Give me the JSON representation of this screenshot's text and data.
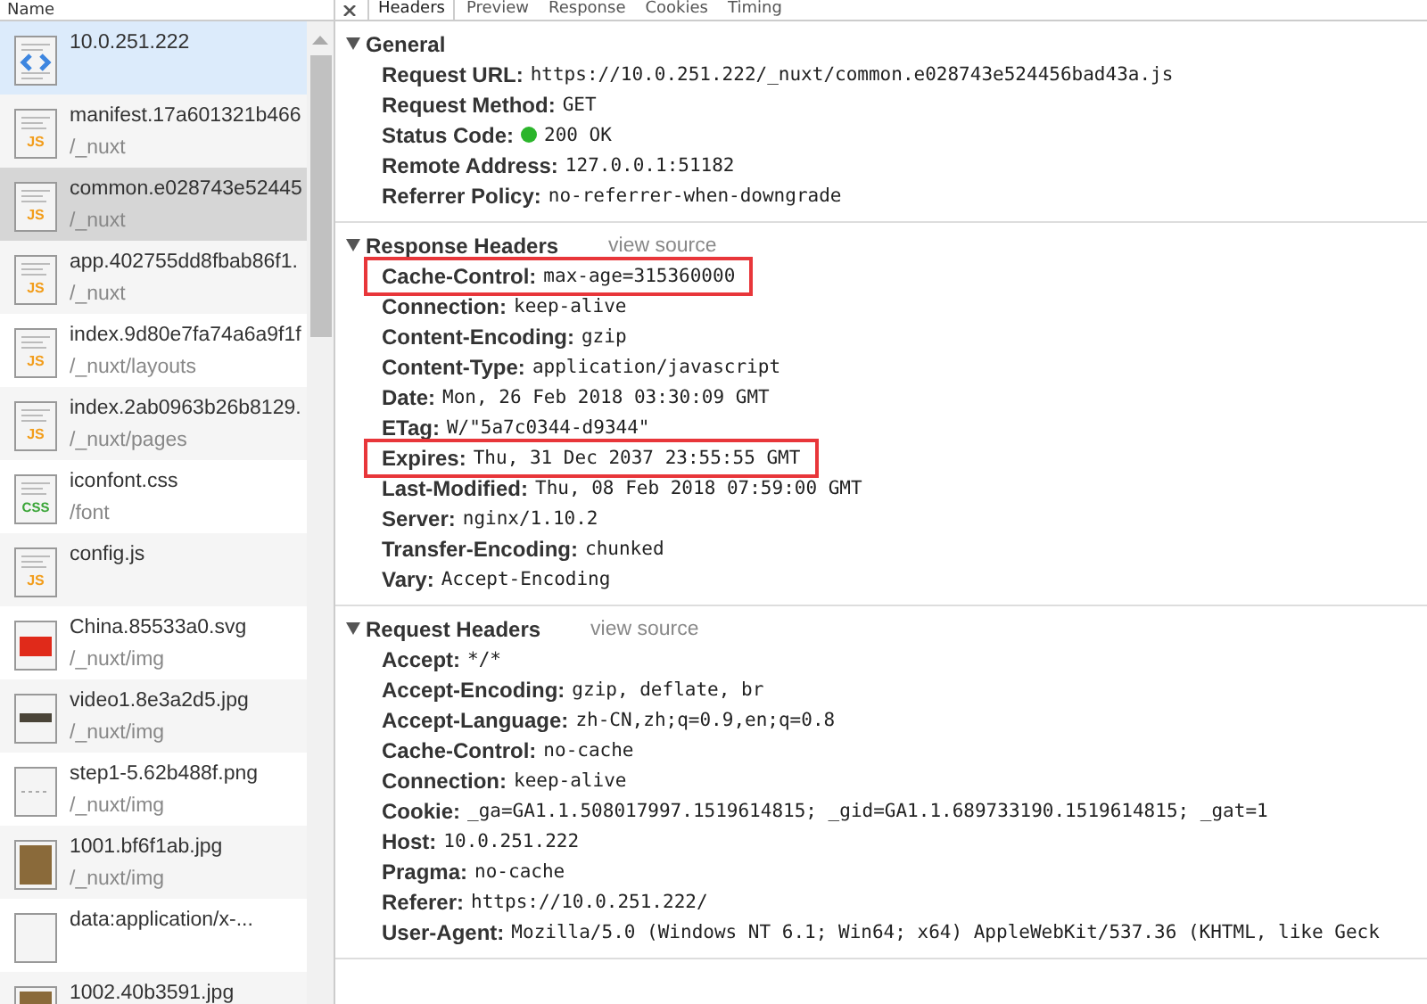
{
  "name_column": {
    "title": "Name"
  },
  "requests": [
    {
      "name": "10.0.251.222",
      "kind": "html",
      "selected": false,
      "highlighted": true
    },
    {
      "name": "manifest.17a601321b466",
      "path": "/_nuxt",
      "kind": "js",
      "icon_label": "JS",
      "selected": false,
      "highlighted": false
    },
    {
      "name": "common.e028743e52445",
      "path": "/_nuxt",
      "kind": "js",
      "icon_label": "JS",
      "selected": true,
      "highlighted": false
    },
    {
      "name": "app.402755dd8fbab86f1.",
      "path": "/_nuxt",
      "kind": "js",
      "icon_label": "JS",
      "selected": false,
      "highlighted": false
    },
    {
      "name": "index.9d80e7fa74a6a9f1f",
      "path": "/_nuxt/layouts",
      "kind": "js",
      "icon_label": "JS",
      "selected": false,
      "highlighted": false
    },
    {
      "name": "index.2ab0963b26b8129.",
      "path": "/_nuxt/pages",
      "kind": "js",
      "icon_label": "JS",
      "selected": false,
      "highlighted": false
    },
    {
      "name": "iconfont.css",
      "path": "/font",
      "kind": "css",
      "icon_label": "CSS",
      "selected": false,
      "highlighted": false
    },
    {
      "name": "config.js",
      "kind": "js",
      "icon_label": "JS",
      "selected": false,
      "highlighted": false
    },
    {
      "name": "China.85533a0.svg",
      "path": "/_nuxt/img",
      "kind": "flag",
      "selected": false,
      "highlighted": false
    },
    {
      "name": "video1.8e3a2d5.jpg",
      "path": "/_nuxt/img",
      "kind": "video",
      "selected": false,
      "highlighted": false
    },
    {
      "name": "step1-5.62b488f.png",
      "path": "/_nuxt/img",
      "kind": "strip",
      "selected": false,
      "highlighted": false
    },
    {
      "name": "1001.bf6f1ab.jpg",
      "path": "/_nuxt/img",
      "kind": "photo",
      "selected": false,
      "highlighted": false
    },
    {
      "name": "data:application/x-...",
      "kind": "blank",
      "selected": false,
      "highlighted": false
    },
    {
      "name": "1002.40b3591.jpg",
      "kind": "photo",
      "selected": false,
      "highlighted": false
    }
  ],
  "tabs": [
    {
      "label": "Headers",
      "selected": true
    },
    {
      "label": "Preview",
      "selected": false
    },
    {
      "label": "Response",
      "selected": false
    },
    {
      "label": "Cookies",
      "selected": false
    },
    {
      "label": "Timing",
      "selected": false
    }
  ],
  "sections": [
    {
      "title": "General",
      "items": [
        {
          "name": "Request URL:",
          "value": "https://10.0.251.222/_nuxt/common.e028743e524456bad43a.js",
          "kind": "plain",
          "highlighted": false
        },
        {
          "name": "Request Method:",
          "value": "GET",
          "kind": "plain",
          "highlighted": false
        },
        {
          "name": "Status Code:",
          "value": "200 OK",
          "kind": "status",
          "highlighted": false
        },
        {
          "name": "Remote Address:",
          "value": "127.0.0.1:51182",
          "kind": "plain",
          "highlighted": false
        },
        {
          "name": "Referrer Policy:",
          "value": "no-referrer-when-downgrade",
          "kind": "plain",
          "highlighted": false
        }
      ]
    },
    {
      "title": "Response Headers",
      "view_source": "view source",
      "items": [
        {
          "name": "Cache-Control:",
          "value": "max-age=315360000",
          "kind": "plain",
          "highlighted": true
        },
        {
          "name": "Connection:",
          "value": "keep-alive",
          "kind": "plain",
          "highlighted": false
        },
        {
          "name": "Content-Encoding:",
          "value": "gzip",
          "kind": "plain",
          "highlighted": false
        },
        {
          "name": "Content-Type:",
          "value": "application/javascript",
          "kind": "plain",
          "highlighted": false
        },
        {
          "name": "Date:",
          "value": "Mon, 26 Feb 2018 03:30:09 GMT",
          "kind": "plain",
          "highlighted": false
        },
        {
          "name": "ETag:",
          "value": "W/\"5a7c0344-d9344\"",
          "kind": "plain",
          "highlighted": false
        },
        {
          "name": "Expires:",
          "value": "Thu, 31 Dec 2037 23:55:55 GMT",
          "kind": "plain",
          "highlighted": true
        },
        {
          "name": "Last-Modified:",
          "value": "Thu, 08 Feb 2018 07:59:00 GMT",
          "kind": "plain",
          "highlighted": false
        },
        {
          "name": "Server:",
          "value": "nginx/1.10.2",
          "kind": "plain",
          "highlighted": false
        },
        {
          "name": "Transfer-Encoding:",
          "value": "chunked",
          "kind": "plain",
          "highlighted": false
        },
        {
          "name": "Vary:",
          "value": "Accept-Encoding",
          "kind": "plain",
          "highlighted": false
        }
      ]
    },
    {
      "title": "Request Headers",
      "view_source": "view source",
      "items": [
        {
          "name": "Accept:",
          "value": "*/*",
          "kind": "plain",
          "highlighted": false
        },
        {
          "name": "Accept-Encoding:",
          "value": "gzip, deflate, br",
          "kind": "plain",
          "highlighted": false
        },
        {
          "name": "Accept-Language:",
          "value": "zh-CN,zh;q=0.9,en;q=0.8",
          "kind": "plain",
          "highlighted": false
        },
        {
          "name": "Cache-Control:",
          "value": "no-cache",
          "kind": "plain",
          "highlighted": false
        },
        {
          "name": "Connection:",
          "value": "keep-alive",
          "kind": "plain",
          "highlighted": false
        },
        {
          "name": "Cookie:",
          "value": "_ga=GA1.1.508017997.1519614815; _gid=GA1.1.689733190.1519614815; _gat=1",
          "kind": "plain",
          "highlighted": false
        },
        {
          "name": "Host:",
          "value": "10.0.251.222",
          "kind": "plain",
          "highlighted": false
        },
        {
          "name": "Pragma:",
          "value": "no-cache",
          "kind": "plain",
          "highlighted": false
        },
        {
          "name": "Referer:",
          "value": "https://10.0.251.222/",
          "kind": "plain",
          "highlighted": false
        },
        {
          "name": "User-Agent:",
          "value": "Mozilla/5.0 (Windows NT 6.1; Win64; x64) AppleWebKit/537.36 (KHTML, like Geck",
          "kind": "plain",
          "highlighted": false
        }
      ]
    }
  ]
}
